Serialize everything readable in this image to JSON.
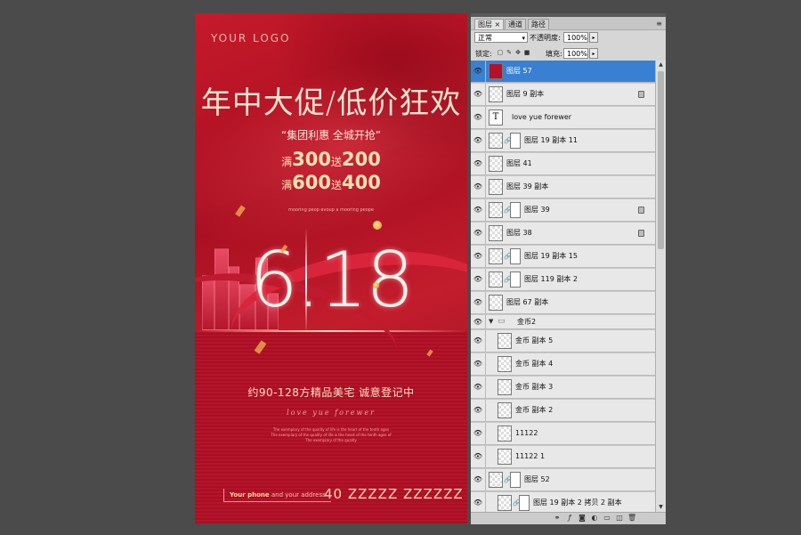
{
  "poster": {
    "logo": "YOUR LOGO",
    "headline": "年中大促/低价狂欢",
    "slogan": "“集团利惠 全城开抢”",
    "offer1": {
      "prefix": "满",
      "amount": "300",
      "mid": "送",
      "bonus": "200"
    },
    "offer2": {
      "prefix": "满",
      "amount": "600",
      "mid": "送",
      "bonus": "400"
    },
    "tagline": "mooring peop evoup a mooring peope",
    "big_number": "6.18",
    "size_text": "约90-128方精品美宅  诚意登记中",
    "script": "love yue forewer",
    "fine_print": [
      "The exemplary of the quality of life is the heart of the tenth ages",
      "The exemplary of the quality of life is the heart of the tenth ages of",
      "The exemplary of the quality"
    ],
    "phone_label": "Your phone",
    "address_label": "and your address",
    "phone_number": "40 ZZZZZ ZZZZZZ"
  },
  "panel": {
    "tabs": [
      {
        "label": "图层",
        "close": "×"
      },
      {
        "label": "通道"
      },
      {
        "label": "路径"
      }
    ],
    "menu_icon": "≡",
    "blend_mode": "正常",
    "opacity_label": "不透明度:",
    "opacity_value": "100%",
    "lock_label": "锁定:",
    "fill_label": "填充:",
    "fill_value": "100%",
    "layers": [
      {
        "name": "图层 57"
      },
      {
        "name": "图层 9 副本"
      },
      {
        "name": "love yue forewer"
      },
      {
        "name": "图层 19 副本 11"
      },
      {
        "name": "图层 41"
      },
      {
        "name": "图层 39 副本"
      },
      {
        "name": "图层 39"
      },
      {
        "name": "图层 38"
      },
      {
        "name": "图层 19 副本 15"
      },
      {
        "name": "图层 119 副本 2"
      },
      {
        "name": "图层 67 副本"
      },
      {
        "name": "金币2"
      },
      {
        "name": "金币 副本 5"
      },
      {
        "name": "金币 副本 4"
      },
      {
        "name": "金币 副本 3"
      },
      {
        "name": "金币 副本 2"
      },
      {
        "name": "11122"
      },
      {
        "name": "11122 1"
      },
      {
        "name": "图层 52"
      },
      {
        "name": "图层 19 副本 2 拷贝 2 副本"
      }
    ],
    "thumb_text_glyph": "T"
  },
  "colors": {
    "selection": "#3a80d2",
    "poster_red": "#b31228",
    "gold": "#ffe2b0"
  }
}
